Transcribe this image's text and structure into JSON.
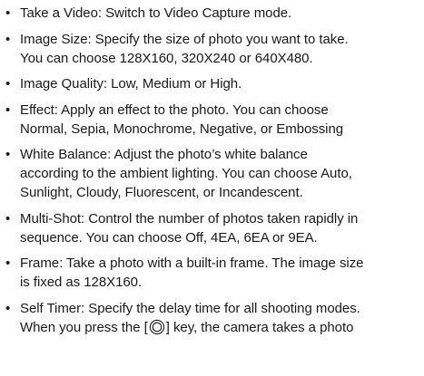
{
  "bullet_symbol": "•",
  "items": [
    {
      "lines": [
        "Take a Video: Switch to Video Capture mode."
      ]
    },
    {
      "lines": [
        "Image Size: Specify the size of photo you want to take.",
        "You can choose 128X160, 320X240 or 640X480."
      ]
    },
    {
      "lines": [
        "Image Quality: Low, Medium or High."
      ]
    },
    {
      "lines": [
        "Effect: Apply an effect to the photo. You can choose",
        "Normal, Sepia, Monochrome, Negative, or Embossing"
      ]
    },
    {
      "lines": [
        "White Balance: Adjust the photo’s white balance",
        "according to the ambient lighting. You can choose Auto,",
        "Sunlight, Cloudy, Fluorescent, or Incandescent."
      ]
    },
    {
      "lines": [
        "Multi-Shot: Control the number of photos taken rapidly in",
        "sequence. You can choose Off, 4EA, 6EA or 9EA."
      ]
    },
    {
      "lines": [
        "Frame: Take a photo with a built-in frame. The image size",
        "is fixed as 128X160."
      ]
    },
    {
      "lines": [
        "Self Timer: Specify the delay time for all shooting modes."
      ],
      "last_line": {
        "before": "When you press the [",
        "icon": "camera-key-icon",
        "after": "] key, the camera takes a photo"
      }
    }
  ]
}
